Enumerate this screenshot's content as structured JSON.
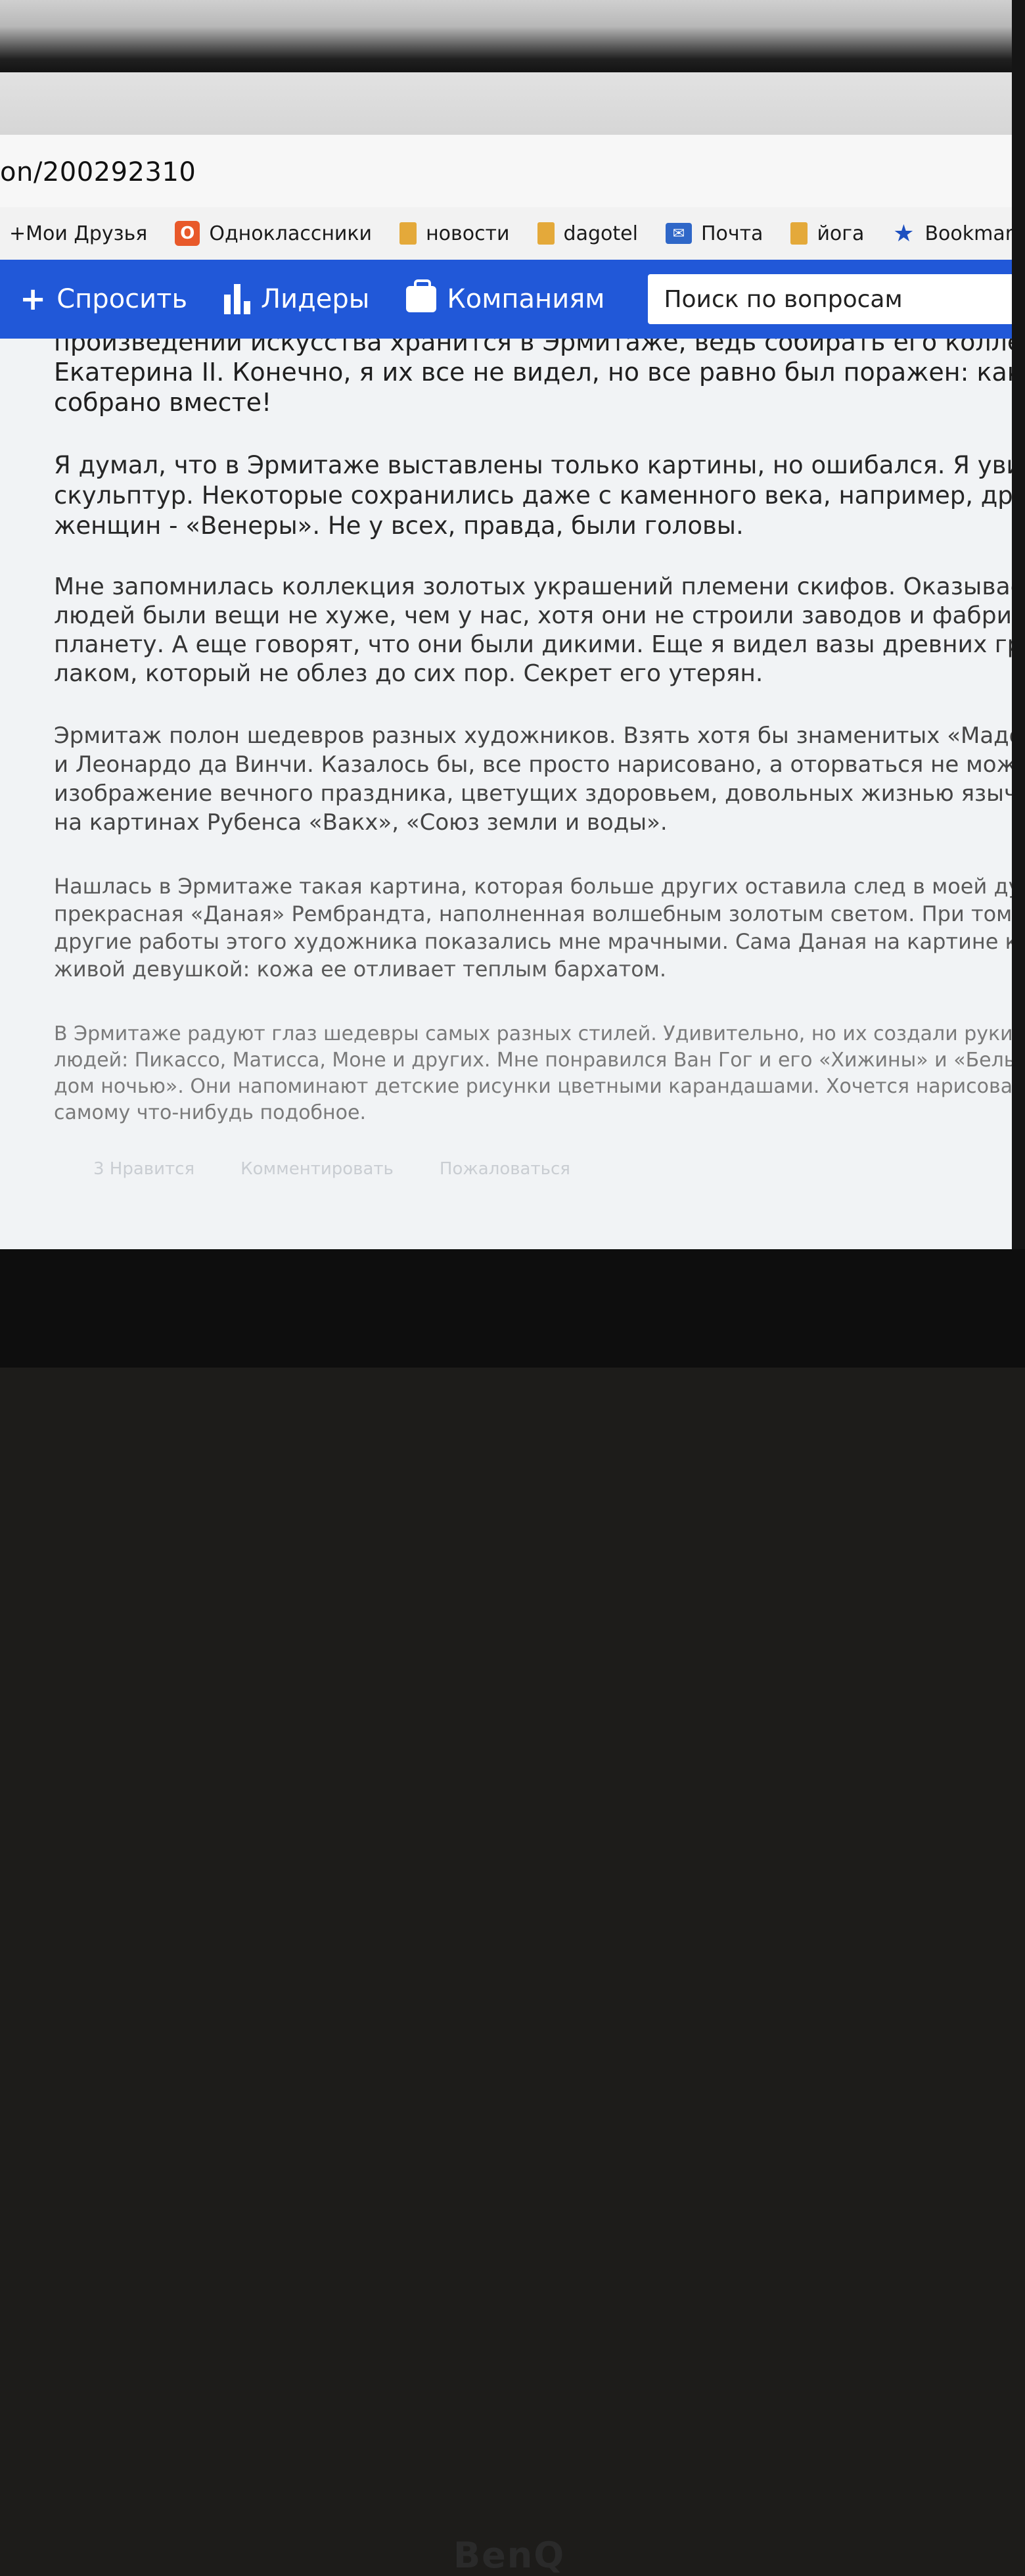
{
  "address": {
    "url_fragment": "on/200292310"
  },
  "bookmarks": [
    {
      "label": "+Мои Друзья",
      "icon": "none"
    },
    {
      "label": "Одноклассники",
      "icon": "odnoklassniki-icon"
    },
    {
      "label": "новости",
      "icon": "folder-icon"
    },
    {
      "label": "dagotel",
      "icon": "folder-icon"
    },
    {
      "label": "Почта",
      "icon": "mail-icon"
    },
    {
      "label": "йога",
      "icon": "folder-icon"
    },
    {
      "label": "Bookmarks",
      "icon": "star-icon"
    }
  ],
  "nav": {
    "ask_label": "Спросить",
    "leaders_label": "Лидеры",
    "companies_label": "Компаниям",
    "search_placeholder": "Поиск по вопросам"
  },
  "article": {
    "p1": [
      "произведений искусства хранится в Эрмитаже, ведь собирать его коллекцию начала ещ",
      "Екатерина II. Конечно, я их все не видел, но все равно был поражен: как много шедевро",
      "собрано вместе!"
    ],
    "p2": [
      "Я думал, что в Эрмитаже выставлены только картины, но ошибался. Я увидел множество",
      "скульптур. Некоторые сохранились даже с каменного века, например, древние статуи",
      "женщин - «Венеры». Не у всех, правда, были головы."
    ],
    "p3": [
      "Мне запомнилась коллекция золотых украшений племени скифов. Оказывается, у древних",
      "людей были вещи не хуже, чем у нас, хотя они не строили заводов и фабрик, не отравляли",
      "планету. А еще говорят, что они были дикими. Еще я видел вазы древних греков, покрытые",
      "лаком, который не облез до сих пор. Секрет его утерян."
    ],
    "p4": [
      "Эрмитаж полон шедевров разных художников. Взять хотя бы знаменитых «Мадонн» Рафаэля",
      "и Леонардо да Винчи. Казалось бы, все просто нарисовано, а оторваться не можешь. Или",
      "изображение вечного праздника, цветущих здоровьем, довольных жизнью языческих богов",
      "на картинах Рубенса «Вакх», «Союз земли и воды»."
    ],
    "p5": [
      "Нашлась в Эрмитаже такая картина, которая больше других оставила след в моей душе. Это",
      "прекрасная «Даная» Рембрандта, наполненная волшебным золотым светом. При том, что",
      "другие работы этого художника показались мне мрачными. Сама Даная на картине кажется",
      "живой девушкой: кожа ее отливает теплым бархатом."
    ],
    "p6": [
      "В Эрмитаже радуют глаз шедевры самых разных стилей. Удивительно, но их создали руки",
      "людей: Пикассо, Матисса, Моне и других. Мне понравился Ван Гог и его «Хижины» и «Белый",
      "дом ночью». Они напоминают детские рисунки цветными карандашами. Хочется нарисовать",
      "самому что-нибудь подобное."
    ]
  },
  "actions": {
    "like_label": "3 Нравится",
    "comment_label": "Комментировать",
    "report_label": "Пожаловаться"
  },
  "monitor": {
    "brand": "BenQ"
  },
  "colors": {
    "navbar": "#2158d8",
    "folder": "#e4a93a",
    "odnoklassniki": "#e8592a"
  }
}
